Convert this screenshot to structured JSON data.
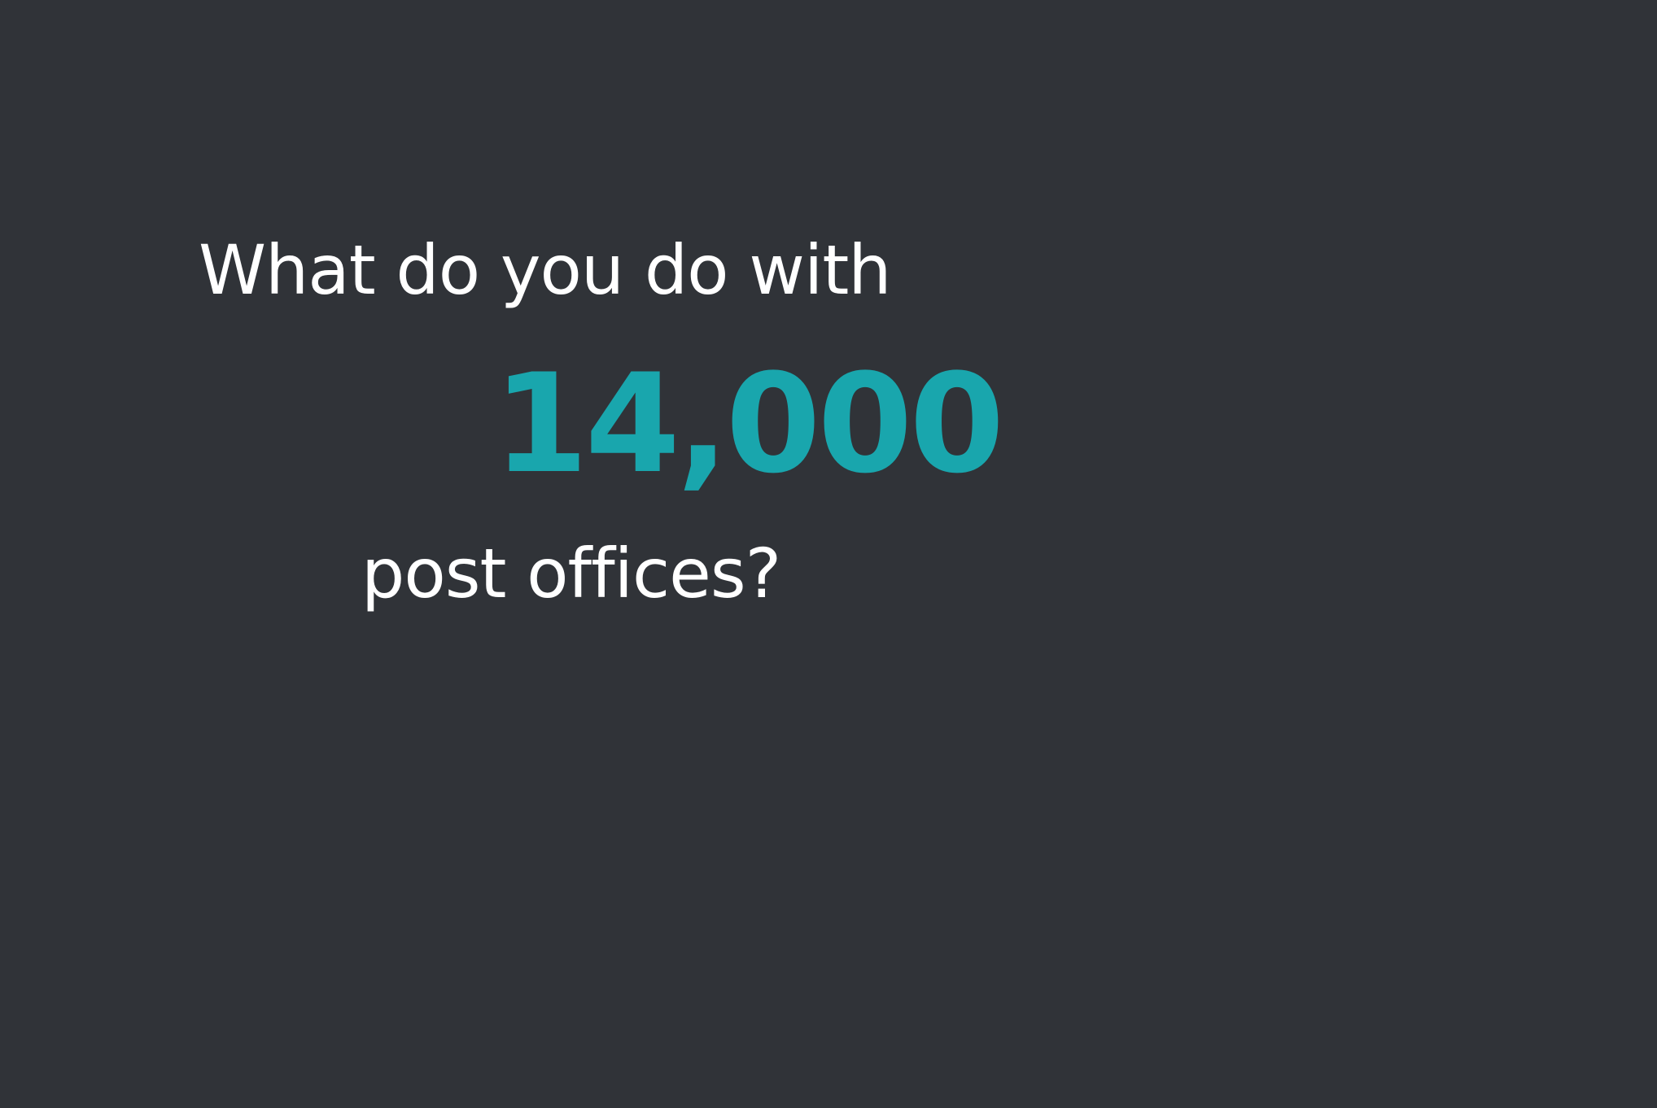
{
  "slide": {
    "line_1": "What do you do with",
    "number": "14,000",
    "line_3": "post offices?"
  },
  "colors": {
    "background": "#303338",
    "text": "#ffffff",
    "accent": "#19a6ad"
  }
}
